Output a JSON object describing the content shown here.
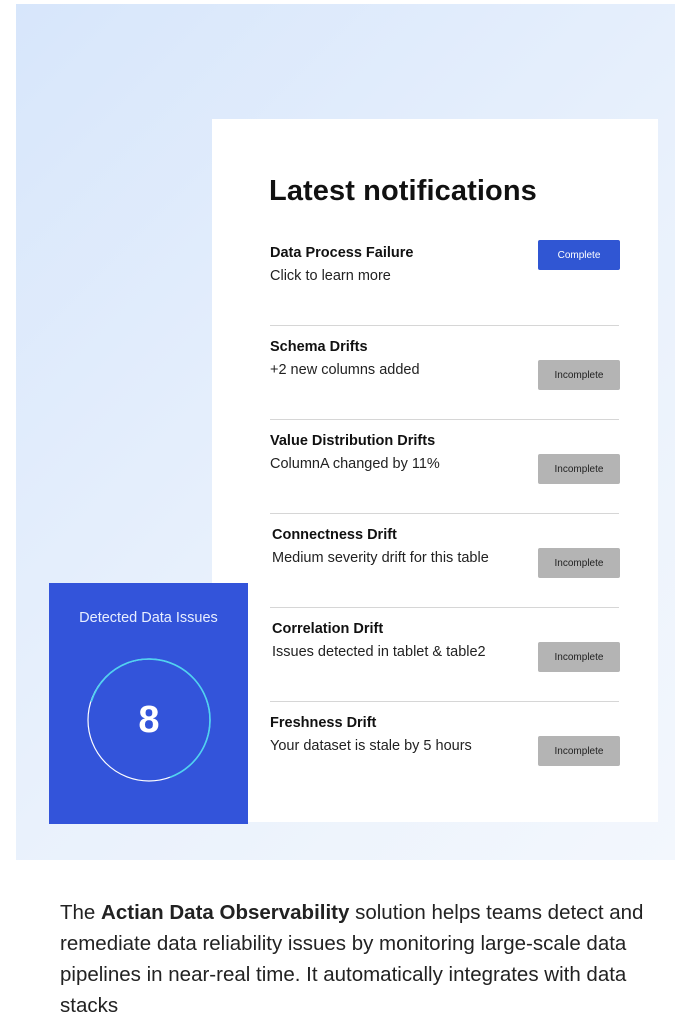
{
  "card": {
    "title": "Latest notifications",
    "items": [
      {
        "title": "Data Process Failure",
        "desc": "Click to learn more",
        "status": "Complete"
      },
      {
        "title": "Schema Drifts",
        "desc": "+2 new columns added",
        "status": "Incomplete"
      },
      {
        "title": "Value Distribution Drifts",
        "desc": "ColumnA changed by 11%",
        "status": "Incomplete"
      },
      {
        "title": "Connectness Drift",
        "desc": "Medium severity drift for this table",
        "status": "Incomplete"
      },
      {
        "title": "Correlation Drift",
        "desc": "Issues detected in tablet & table2",
        "status": "Incomplete"
      },
      {
        "title": "Freshness Drift",
        "desc": "Your dataset is stale by 5 hours",
        "status": "Incomplete"
      }
    ]
  },
  "issues": {
    "label": "Detected Data Issues",
    "count": "8"
  },
  "body": {
    "pre": "The ",
    "brand": "Actian Data Observability",
    "post": " solution helps teams detect and remediate data reliability issues by monitoring large-scale data pipelines in near-real time. It automatically integrates with data stacks"
  },
  "colors": {
    "accent": "#3354da",
    "complete": "#3056d3",
    "incomplete": "#b4b4b4",
    "ring": "#4fd3f0"
  }
}
